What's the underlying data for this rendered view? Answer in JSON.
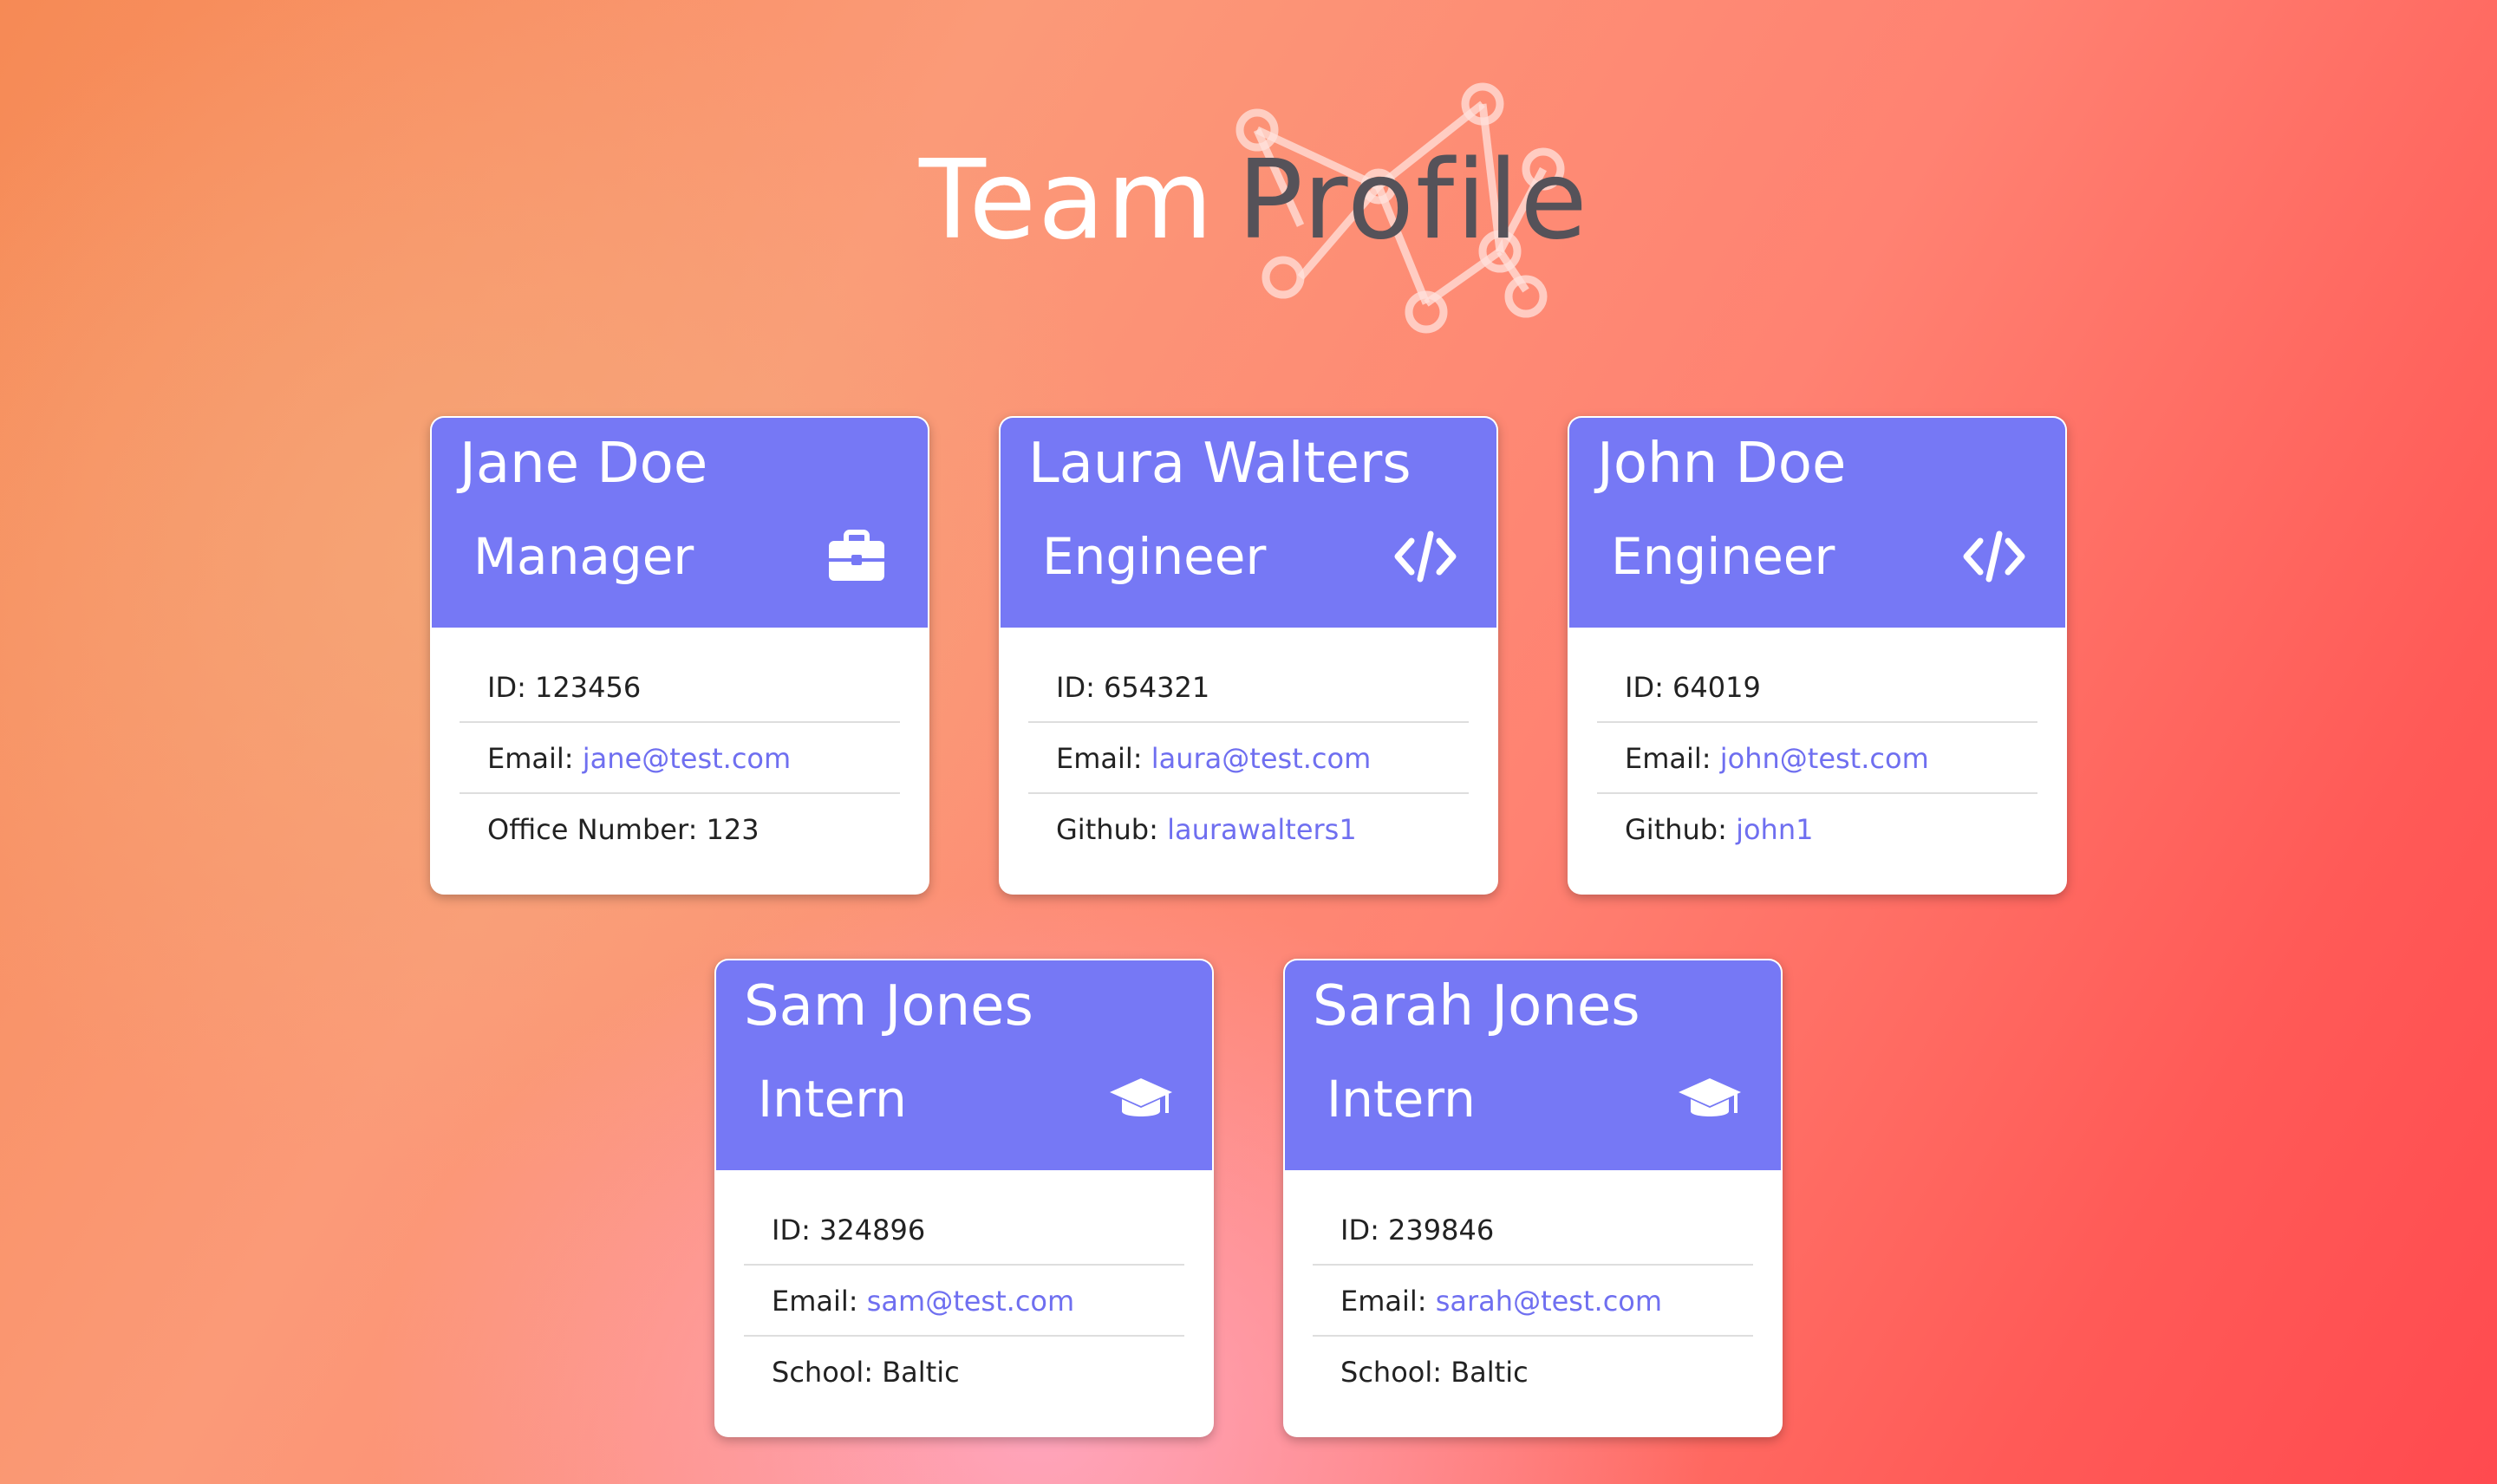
{
  "header": {
    "title_word1": "Team",
    "title_word2": "Profile"
  },
  "colors": {
    "card_header": "#7678f5",
    "link": "#6f6ff0",
    "title_dark": "#555259"
  },
  "cards": [
    {
      "name": "Jane Doe",
      "role": "Manager",
      "icon": "briefcase-icon",
      "id_label": "ID: ",
      "id": "123456",
      "email_label": "Email: ",
      "email": "jane@test.com",
      "extra_label": "Office Number: ",
      "extra": "123"
    },
    {
      "name": "Laura Walters",
      "role": "Engineer",
      "icon": "code-icon",
      "id_label": "ID: ",
      "id": "654321",
      "email_label": "Email: ",
      "email": "laura@test.com",
      "extra_label": "Github: ",
      "extra": "laurawalters1"
    },
    {
      "name": "John Doe",
      "role": "Engineer",
      "icon": "code-icon",
      "id_label": "ID: ",
      "id": "64019",
      "email_label": "Email: ",
      "email": "john@test.com",
      "extra_label": "Github: ",
      "extra": "john1"
    },
    {
      "name": "Sam Jones",
      "role": "Intern",
      "icon": "graduation-cap-icon",
      "id_label": "ID: ",
      "id": "324896",
      "email_label": "Email: ",
      "email": "sam@test.com",
      "extra_label": "School: ",
      "extra": "Baltic"
    },
    {
      "name": "Sarah Jones",
      "role": "Intern",
      "icon": "graduation-cap-icon",
      "id_label": "ID: ",
      "id": "239846",
      "email_label": "Email: ",
      "email": "sarah@test.com",
      "extra_label": "School: ",
      "extra": "Baltic"
    }
  ]
}
